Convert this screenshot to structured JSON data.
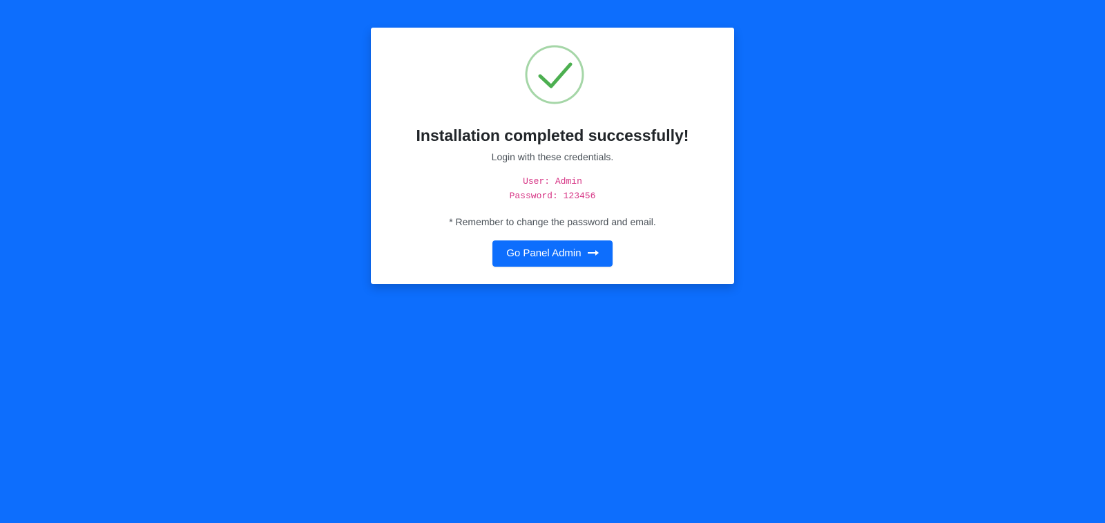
{
  "card": {
    "title": "Installation completed successfully!",
    "subtitle": "Login with these credentials.",
    "credentials": {
      "user_line": "User: Admin",
      "password_line": "Password: 123456"
    },
    "reminder": "* Remember to change the password and email.",
    "button_label": "Go Panel Admin"
  },
  "icons": {
    "success": "check-circle-icon",
    "button_arrow": "arrow-right-icon"
  },
  "colors": {
    "background": "#0d6efd",
    "card": "#ffffff",
    "success_circle": "#a5d6a7",
    "success_check": "#4caf50",
    "credentials_text": "#d63384",
    "button": "#0d6efd"
  }
}
